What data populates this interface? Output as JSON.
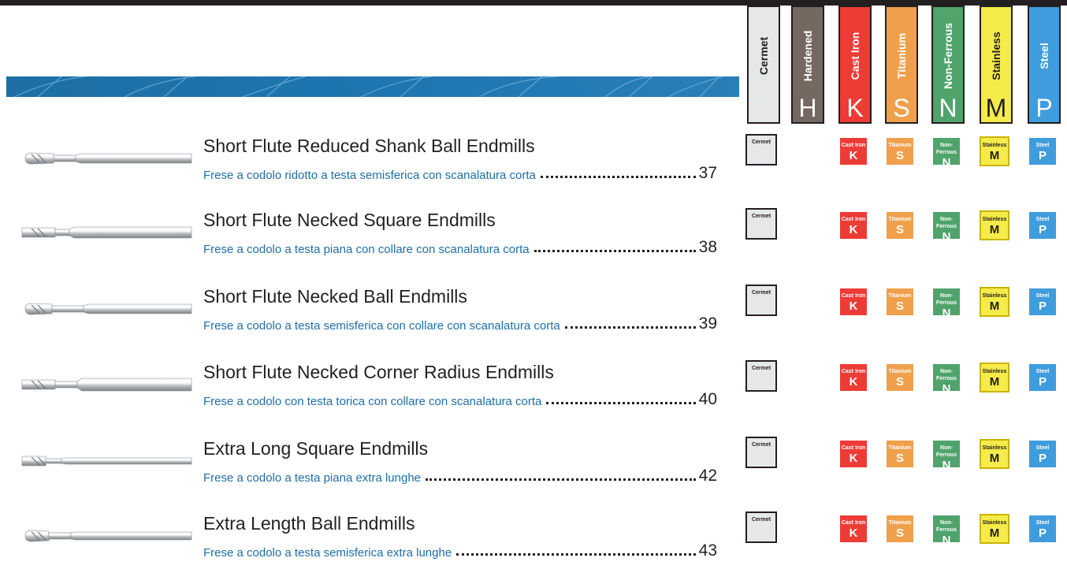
{
  "materials": [
    {
      "key": "cermet",
      "name": "Cermet",
      "letter": "",
      "color": "#e6e7e8",
      "text_color": "#231f20"
    },
    {
      "key": "hardened",
      "name": "Hardened",
      "letter": "H",
      "color": "#756861",
      "text_color": "#ffffff"
    },
    {
      "key": "cast-iron",
      "name": "Cast Iron",
      "letter": "K",
      "color": "#ed3b36",
      "text_color": "#ffffff"
    },
    {
      "key": "titanium",
      "name": "Titanium",
      "letter": "S",
      "color": "#f0a04b",
      "text_color": "#ffffff"
    },
    {
      "key": "non-ferrous",
      "name": "Non-Ferrous",
      "letter": "N",
      "color": "#4fa36b",
      "text_color": "#ffffff"
    },
    {
      "key": "stainless",
      "name": "Stainless",
      "letter": "M",
      "color": "#f5eb4a",
      "text_color": "#231f20"
    },
    {
      "key": "steel",
      "name": "Steel",
      "letter": "P",
      "color": "#3f9ddd",
      "text_color": "#ffffff"
    }
  ],
  "products": [
    {
      "title": "Short Flute Reduced Shank Ball Endmills",
      "subtitle": "Frese a codolo ridotto a testa semisferica con scanalatura corta",
      "page": "37",
      "tool": "ball-reduced-shank"
    },
    {
      "title": "Short Flute Necked Square Endmills",
      "subtitle": "Frese a codolo a testa piana con collare con scanalatura corta",
      "page": "38",
      "tool": "square-necked"
    },
    {
      "title": "Short Flute Necked Ball Endmills",
      "subtitle": "Frese a codolo a testa semisferica con collare con scanalatura corta",
      "page": "39",
      "tool": "ball-necked"
    },
    {
      "title": "Short Flute Necked Corner Radius Endmills",
      "subtitle": "Frese a codolo con testa torica con collare con scanalatura corta",
      "page": "40",
      "tool": "corner-radius-necked"
    },
    {
      "title": "Extra Long Square Endmills",
      "subtitle": "Frese a codolo a testa piana extra lunghe",
      "page": "42",
      "tool": "square-extra-long"
    },
    {
      "title": "Extra Length Ball Endmills",
      "subtitle": "Frese a codolo a testa semisferica extra lunghe",
      "page": "43",
      "tool": "ball-extra-long"
    }
  ]
}
